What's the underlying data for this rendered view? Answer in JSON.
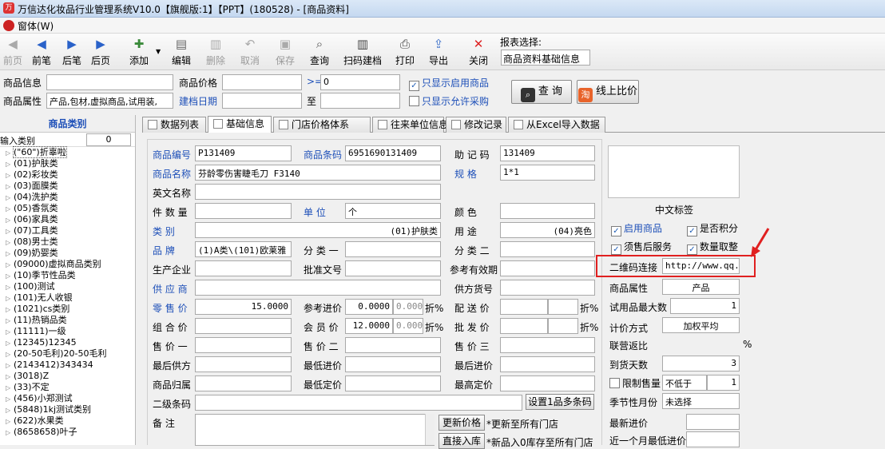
{
  "window": {
    "title": "万信达化妆品行业管理系统V10.0【旗舰版:1】【PPT】(180528) - [商品资料]"
  },
  "menu": {
    "window_label": "窗体(W)"
  },
  "toolbar": {
    "buttons": [
      {
        "label": "前页",
        "icon": "first-page-icon",
        "disabled": true
      },
      {
        "label": "前笔",
        "icon": "prev-icon",
        "disabled": false
      },
      {
        "label": "后笔",
        "icon": "next-icon",
        "disabled": false
      },
      {
        "label": "后页",
        "icon": "last-page-icon",
        "disabled": false
      },
      {
        "label": "添加",
        "icon": "add-icon",
        "disabled": false
      },
      {
        "label": "编辑",
        "icon": "edit-icon",
        "disabled": false
      },
      {
        "label": "删除",
        "icon": "delete-icon",
        "disabled": true
      },
      {
        "label": "取消",
        "icon": "undo-icon",
        "disabled": true
      },
      {
        "label": "保存",
        "icon": "save-icon",
        "disabled": true
      },
      {
        "label": "查询",
        "icon": "search-icon",
        "disabled": false
      },
      {
        "label": "扫码建档",
        "icon": "barcode-icon",
        "disabled": false
      },
      {
        "label": "打印",
        "icon": "print-icon",
        "disabled": false
      },
      {
        "label": "导出",
        "icon": "export-icon",
        "disabled": false
      },
      {
        "label": "关闭",
        "icon": "close-icon",
        "disabled": false
      }
    ],
    "report_label": "报表选择:",
    "report_value": "商品资料基础信息"
  },
  "filter": {
    "product_info_label": "商品信息",
    "product_price_label": "商品价格",
    "gte_label": ">=",
    "price_value": "0",
    "only_enabled_label": "只显示启用商品",
    "only_enabled_checked": true,
    "product_attr_label": "商品属性",
    "product_attr_value": "产品,包材,虚拟商品,试用装,",
    "create_date_label": "建档日期",
    "to_label": "至",
    "only_purchase_label": "只显示允许采购",
    "only_purchase_checked": false,
    "query_button": "查 询",
    "online_compare_button": "线上比价"
  },
  "category": {
    "title": "商品类别",
    "input_label": "输入类别",
    "input_value": "0",
    "items": [
      "(\"60\")折辜啦",
      "(01)护肤类",
      "(02)彩妆类",
      "(03)面膜类",
      "(04)洗护类",
      "(05)香氛类",
      "(06)家具类",
      "(07)工具类",
      "(08)男士类",
      "(09)奶婴类",
      "(09000)虚拟商品类别",
      "(10)季节性品类",
      "(100)测试",
      "(101)无人收银",
      "(1021)cs类别",
      "(11)热销品类",
      "(11111)一级",
      "(12345)12345",
      "(20-50毛利)20-50毛利",
      "(2143412)343434",
      "(3018)Z",
      "(33)不定",
      "(456)小郑测试",
      "(5848)1kj测试类别",
      "(622)水果类",
      "(8658658)叶子"
    ]
  },
  "tabs": [
    "数据列表",
    "基础信息",
    "门店价格体系",
    "往来单位信息",
    "修改记录",
    "从Excel导入数据"
  ],
  "form": {
    "code_label": "商品编号",
    "code_value": "P131409",
    "barcode_label": "商品条码",
    "barcode_value": "6951690131409",
    "mnemonic_label": "助 记 码",
    "mnemonic_value": "131409",
    "name_label": "商品名称",
    "name_value": "芬龄零伤害睫毛刀 F3140",
    "spec_label": "规   格",
    "spec_value": "1*1",
    "en_name_label": "英文名称",
    "pieces_label": "件 数 量",
    "unit_label": "单   位",
    "unit_value": "个",
    "color_label": "颜   色",
    "cat_label": "类   别",
    "cat_value": "(01)护肤类",
    "usage_label": "用   途",
    "usage_value": "(04)亮色",
    "brand_label": "品   牌",
    "brand_value": "(1)A类\\(101)欧莱雅",
    "class1_label": "分 类 一",
    "class2_label": "分 类 二",
    "manufacturer_label": "生产企业",
    "approval_label": "批准文号",
    "expiry_label": "参考有效期",
    "supplier_label": "供 应 商",
    "supplier_code_label": "供方货号",
    "retail_label": "零 售 价",
    "retail_value": "15.0000",
    "ref_cost_label": "参考进价",
    "ref_cost_value": "0.0000",
    "ref_cost_pct": "0.0000",
    "discount_label": "折%",
    "delivery_label": "配 送 价",
    "combo_label": "组 合 价",
    "member_label": "会 员 价",
    "member_value": "12.0000",
    "member_pct": "0.0000",
    "wholesale_label": "批 发 价",
    "price1_label": "售 价 一",
    "price2_label": "售 价 二",
    "price3_label": "售 价 三",
    "last_supplier_label": "最后供方",
    "lowest_cost_label": "最低进价",
    "last_cost_label": "最后进价",
    "owner_label": "商品归属",
    "lowest_price_label": "最低定价",
    "highest_price_label": "最高定价",
    "sub_barcode_label": "二级条码",
    "multi_barcode_button": "设置1品多条码",
    "remark_label": "备   注",
    "update_price_button": "更新价格",
    "update_price_note": "*更新至所有门店",
    "direct_store_button": "直接入库",
    "direct_store_note": "*新品入0库存至所有门店"
  },
  "right": {
    "cn_label": "中文标签",
    "enable_label": "启用商品",
    "enable_checked": true,
    "points_label": "是否积分",
    "points_checked": true,
    "aftersale_label": "须售后服务",
    "aftersale_checked": true,
    "round_label": "数量取整",
    "round_checked": true,
    "qr_label": "二维码连接",
    "qr_value": "http://www.qq.co",
    "attr_label": "商品属性",
    "attr_value": "产品",
    "trial_label": "试用品最大数",
    "trial_value": "1",
    "pricing_label": "计价方式",
    "pricing_value": "加权平均",
    "rebate_label": "联营返比",
    "rebate_unit": "%",
    "arrival_label": "到货天数",
    "arrival_value": "3",
    "limit_label": "限制售量",
    "limit_checked": false,
    "limit_mode": "不低于",
    "limit_value": "1",
    "season_label": "季节性月份",
    "season_value": "未选择",
    "latest_cost_label": "最新进价",
    "month_low_label": "近一个月最低进价"
  }
}
